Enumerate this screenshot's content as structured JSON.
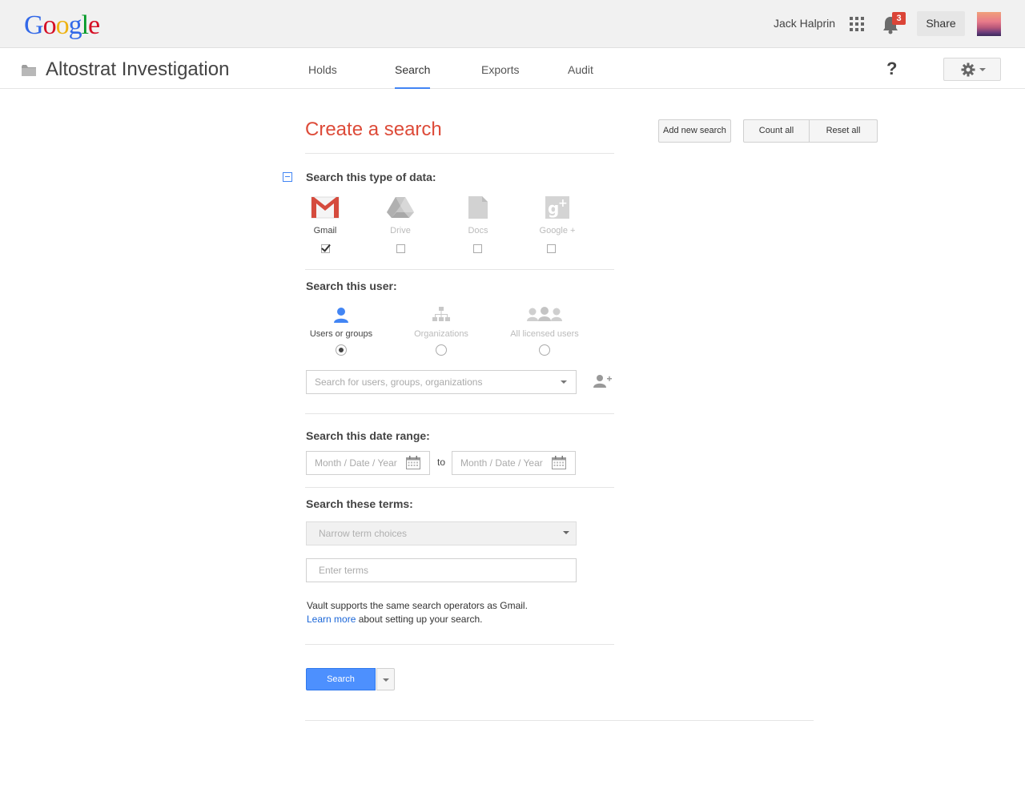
{
  "header": {
    "logo_letters": [
      "G",
      "o",
      "o",
      "g",
      "l",
      "e"
    ],
    "logo_colors": [
      "#3369e8",
      "#d50f25",
      "#eeb211",
      "#3369e8",
      "#009925",
      "#d50f25"
    ],
    "user_name": "Jack Halprin",
    "notification_count": "3",
    "share_label": "Share"
  },
  "subheader": {
    "title": "Altostrat Investigation",
    "tabs": [
      {
        "label": "Holds"
      },
      {
        "label": "Search"
      },
      {
        "label": "Exports"
      },
      {
        "label": "Audit"
      }
    ],
    "active_tab": "Search",
    "help_label": "?"
  },
  "main": {
    "title": "Create a search",
    "add_new_search_label": "Add new search",
    "count_all_label": "Count all",
    "reset_all_label": "Reset all",
    "data_type": {
      "label": "Search this type of data:",
      "options": [
        {
          "label": "Gmail",
          "checked": true
        },
        {
          "label": "Drive",
          "checked": false
        },
        {
          "label": "Docs",
          "checked": false
        },
        {
          "label": "Google +",
          "checked": false
        }
      ]
    },
    "user": {
      "label": "Search this user:",
      "options": [
        {
          "label": "Users or groups",
          "selected": true
        },
        {
          "label": "Organizations",
          "selected": false
        },
        {
          "label": "All licensed users",
          "selected": false
        }
      ],
      "search_placeholder": "Search for users, groups, organizations"
    },
    "date_range": {
      "label": "Search this date range:",
      "from_placeholder": "Month / Date / Year",
      "to_label": "to",
      "to_placeholder": "Month / Date / Year"
    },
    "terms": {
      "label": "Search these terms:",
      "narrow_placeholder": "Narrow term choices",
      "enter_placeholder": "Enter terms",
      "note_line1": "Vault supports the same search operators as Gmail.",
      "note_link": "Learn more",
      "note_line2_rest": " about setting up your search."
    },
    "search_button_label": "Search"
  },
  "colors": {
    "accent_blue": "#4285f4",
    "title_red": "#dd4b39",
    "link_blue": "#1a66d8"
  }
}
